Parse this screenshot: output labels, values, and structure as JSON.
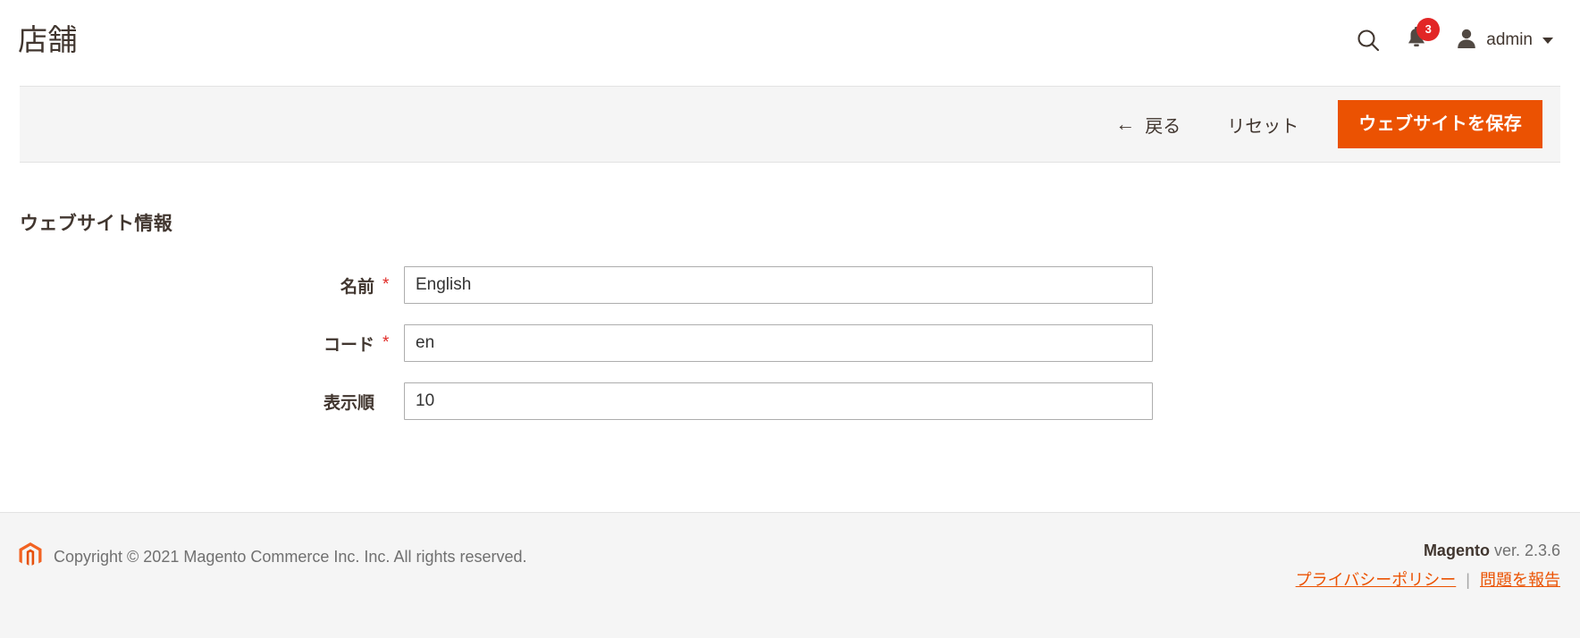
{
  "header": {
    "title": "店舗",
    "search_icon": "search-icon",
    "notifications": {
      "icon": "bell-icon",
      "count": "3"
    },
    "user": {
      "icon": "user-avatar-icon",
      "name": "admin",
      "caret": "chevron-down-icon"
    }
  },
  "page_actions": {
    "back_arrow": "←",
    "back_label": "戻る",
    "reset_label": "リセット",
    "save_label": "ウェブサイトを保存"
  },
  "main": {
    "section_title": "ウェブサイト情報",
    "fields": [
      {
        "label": "名前",
        "required": "*",
        "value": "English"
      },
      {
        "label": "コード",
        "required": "*",
        "value": "en"
      },
      {
        "label": "表示順",
        "required": "",
        "value": "10"
      }
    ]
  },
  "footer": {
    "logo": "magento-logo-icon",
    "copyright": "Copyright © 2021 Magento Commerce Inc. Inc. All rights reserved.",
    "brand": "Magento",
    "version": " ver. 2.3.6",
    "privacy_label": "プライバシーポリシー",
    "separator": "|",
    "report_label": "問題を報告"
  },
  "colors": {
    "accent_orange": "#eb5202",
    "badge_red": "#e22626",
    "panel_gray": "#f5f5f5",
    "text_dark": "#41362f",
    "border_gray": "#e3e3e3",
    "input_border": "#adadad",
    "required_red": "#e02b27"
  }
}
